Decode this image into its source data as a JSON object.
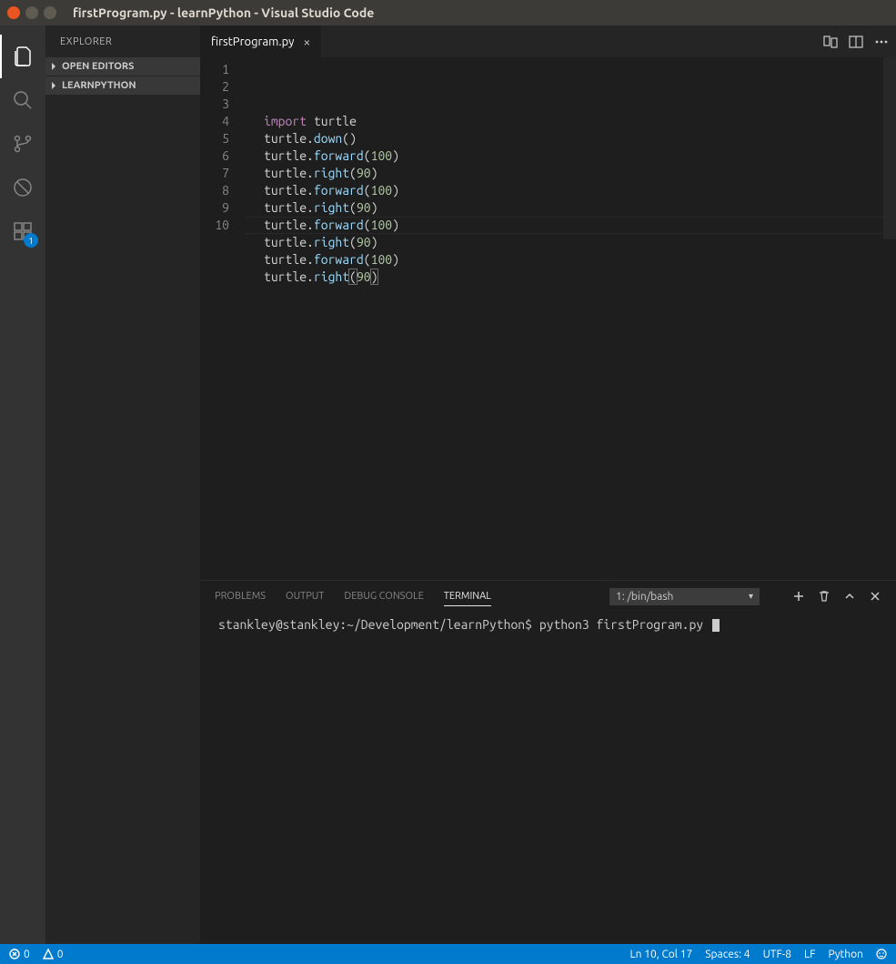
{
  "window": {
    "title": "firstProgram.py - learnPython - Visual Studio Code"
  },
  "activity": {
    "badge": "1"
  },
  "sidebar": {
    "title": "EXPLORER",
    "sections": [
      {
        "label": "OPEN EDITORS"
      },
      {
        "label": "LEARNPYTHON"
      }
    ]
  },
  "tabs": {
    "active": "firstProgram.py"
  },
  "editor": {
    "line_numbers": [
      "1",
      "2",
      "3",
      "4",
      "5",
      "6",
      "7",
      "8",
      "9",
      "10"
    ],
    "lines": [
      {
        "tokens": [
          [
            "kw",
            "import"
          ],
          [
            "sp",
            " "
          ],
          [
            "id",
            "turtle"
          ]
        ]
      },
      {
        "tokens": [
          [
            "id",
            "turtle"
          ],
          [
            "pn",
            "."
          ],
          [
            "fn",
            "down"
          ],
          [
            "pn",
            "()"
          ]
        ]
      },
      {
        "tokens": [
          [
            "id",
            "turtle"
          ],
          [
            "pn",
            "."
          ],
          [
            "fn",
            "forward"
          ],
          [
            "pn",
            "("
          ],
          [
            "num",
            "100"
          ],
          [
            "pn",
            ")"
          ]
        ]
      },
      {
        "tokens": [
          [
            "id",
            "turtle"
          ],
          [
            "pn",
            "."
          ],
          [
            "fn",
            "right"
          ],
          [
            "pn",
            "("
          ],
          [
            "num",
            "90"
          ],
          [
            "pn",
            ")"
          ]
        ]
      },
      {
        "tokens": [
          [
            "id",
            "turtle"
          ],
          [
            "pn",
            "."
          ],
          [
            "fn",
            "forward"
          ],
          [
            "pn",
            "("
          ],
          [
            "num",
            "100"
          ],
          [
            "pn",
            ")"
          ]
        ]
      },
      {
        "tokens": [
          [
            "id",
            "turtle"
          ],
          [
            "pn",
            "."
          ],
          [
            "fn",
            "right"
          ],
          [
            "pn",
            "("
          ],
          [
            "num",
            "90"
          ],
          [
            "pn",
            ")"
          ]
        ]
      },
      {
        "tokens": [
          [
            "id",
            "turtle"
          ],
          [
            "pn",
            "."
          ],
          [
            "fn",
            "forward"
          ],
          [
            "pn",
            "("
          ],
          [
            "num",
            "100"
          ],
          [
            "pn",
            ")"
          ]
        ]
      },
      {
        "tokens": [
          [
            "id",
            "turtle"
          ],
          [
            "pn",
            "."
          ],
          [
            "fn",
            "right"
          ],
          [
            "pn",
            "("
          ],
          [
            "num",
            "90"
          ],
          [
            "pn",
            ")"
          ]
        ]
      },
      {
        "tokens": [
          [
            "id",
            "turtle"
          ],
          [
            "pn",
            "."
          ],
          [
            "fn",
            "forward"
          ],
          [
            "pn",
            "("
          ],
          [
            "num",
            "100"
          ],
          [
            "pn",
            ")"
          ]
        ]
      },
      {
        "tokens": [
          [
            "id",
            "turtle"
          ],
          [
            "pn",
            "."
          ],
          [
            "fn",
            "right"
          ],
          [
            "pn-hl",
            "("
          ],
          [
            "num",
            "90"
          ],
          [
            "pn-hl",
            ")"
          ]
        ]
      }
    ],
    "current_line_index": 9
  },
  "panel": {
    "tabs": {
      "problems": "PROBLEMS",
      "output": "OUTPUT",
      "debug": "DEBUG CONSOLE",
      "terminal": "TERMINAL"
    },
    "select": "1: /bin/bash",
    "terminal": {
      "prompt": "stankley@stankley:~/Development/learnPython$",
      "command": "python3 firstProgram.py"
    }
  },
  "status": {
    "errors": "0",
    "warnings": "0",
    "ln_col": "Ln 10, Col 17",
    "spaces": "Spaces: 4",
    "encoding": "UTF-8",
    "eol": "LF",
    "lang": "Python"
  }
}
